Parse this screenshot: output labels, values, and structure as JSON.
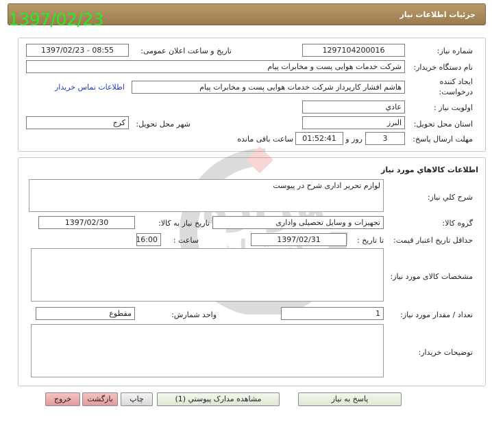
{
  "stamp_date": "1397/02/23",
  "header": {
    "title": "جزئیات اطلاعات نیاز"
  },
  "details": {
    "need_number_label": "شماره نیاز:",
    "need_number": "1297104200016",
    "announce_label": "تاریخ و ساعت اعلان عمومی:",
    "announce_value": "1397/02/23 - 08:55",
    "buyer_org_label": "نام دستگاه خریدار:",
    "buyer_org": "شرکت خدمات هوایی پست و مخابرات پیام",
    "creator_label_1": "ایجاد کننده",
    "creator_label_2": "درخواست:",
    "creator": "هاشم افشار کارپرداز شرکت خدمات هوایی پست و مخابرات پیام",
    "contact_link": "اطلاعات تماس خریدار",
    "priority_label": "اولویت نیاز :",
    "priority": "عادي",
    "province_label": "استان محل تحویل:",
    "province": "البرز",
    "city_label": "شهر محل تحویل:",
    "city": "کرج",
    "deadline_label": "مهلت ارسال پاسخ:",
    "deadline_days": "3",
    "days_text": "روز و",
    "deadline_time": "01:52:41",
    "remaining_text": "ساعت باقی مانده"
  },
  "goods": {
    "section_title": "اطلاعات کالاهاي مورد نياز",
    "desc_label": "شرح كلي نياز:",
    "desc": "لوازم تحریر اداری شرح در پیوست",
    "group_label": "گروه کالا:",
    "group": "تجهیزات و وسایل تحصیلی واداری",
    "need_date_label": "تاریخ نیاز به کالا:",
    "need_date": "1397/02/30",
    "min_price_label": "حداقل تاریخ اعتبار قیمت:",
    "to_date_label": "تا تاریخ :",
    "to_date": "1397/02/31",
    "time_label": "ساعت :",
    "time": "16:00",
    "specs_label": "مشخصات کالای مورد نیاز:",
    "qty_label": "تعداد / مقدار مورد نیاز:",
    "qty": "1",
    "unit_label": "واحد شمارش:",
    "unit": "مقطوع",
    "buyer_notes_label": "توضیحات خریدار:"
  },
  "buttons": {
    "reply": "پاسخ به نیاز",
    "view_docs": "مشاهده مدارک پیوستي (1)",
    "print": "چاپ",
    "back": "بازگشت",
    "exit": "خروج"
  },
  "watermark": {
    "word1": "هزاره",
    "word2": "گستران",
    "word3": "ارتباط"
  }
}
